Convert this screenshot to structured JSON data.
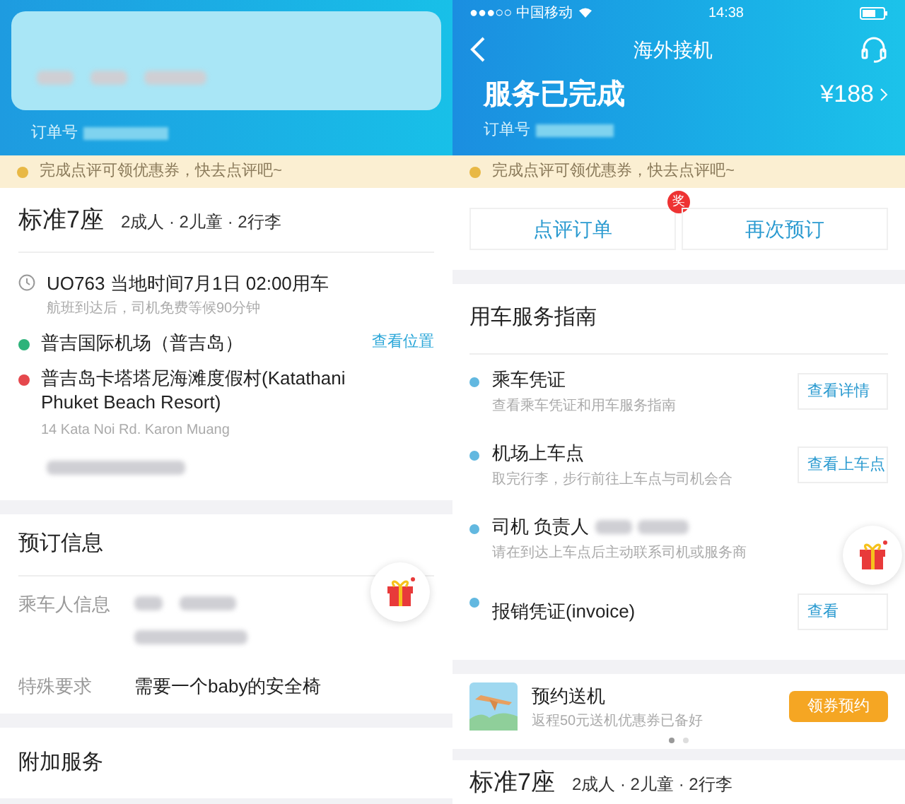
{
  "left": {
    "order_label": "订单号",
    "notice": "完成点评可领优惠券，快去点评吧~",
    "vehicle": {
      "name": "标准7座",
      "specs": "2成人 · 2儿童 · 2行李"
    },
    "flight": {
      "title": "UO763 当地时间7月1日 02:00用车",
      "note": "航班到达后，司机免费等候90分钟"
    },
    "stops": [
      {
        "name": "普吉国际机场（普吉岛）",
        "color": "#2db37a",
        "link": "查看位置"
      },
      {
        "name": "普吉岛卡塔塔尼海滩度假村(Katathani Phuket Beach Resort)",
        "color": "#e5484d",
        "address": "14 Kata Noi Rd. Karon Muang"
      }
    ],
    "booking": {
      "title": "预订信息",
      "rows": [
        {
          "label": "乘车人信息",
          "kind": "blurred"
        },
        {
          "label": "特殊要求",
          "kind": "text",
          "value": "需要一个baby的安全椅"
        }
      ]
    },
    "extra": {
      "title": "附加服务"
    }
  },
  "right": {
    "status_bar": {
      "carrier": "●●●○○ 中国移动",
      "time": "14:38"
    },
    "nav_title": "海外接机",
    "status": "服务已完成",
    "price": "¥188",
    "order_label": "订单号",
    "notice": "完成点评可领优惠券，快去点评吧~",
    "actions": [
      {
        "label": "点评订单",
        "badge": "奖"
      },
      {
        "label": "再次预订"
      }
    ],
    "guide": {
      "title": "用车服务指南",
      "items": [
        {
          "title": "乘车凭证",
          "note": "查看乘车凭证和用车服务指南",
          "button": "查看详情"
        },
        {
          "title": "机场上车点",
          "note": "取完行李，步行前往上车点与司机会合",
          "button": "查看上车点"
        },
        {
          "title": "司机 负责人",
          "note": "请在到达上车点后主动联系司机或服务商",
          "blurred": true
        },
        {
          "title": "报销凭证(invoice)",
          "button": "查看"
        }
      ]
    },
    "promo": {
      "title": "预约送机",
      "note": "返程50元送机优惠券已备好",
      "button": "领券预约"
    },
    "carousel": [
      {
        "selected": true
      },
      {
        "selected": false
      }
    ],
    "vehicle": {
      "name": "标准7座",
      "specs": "2成人 · 2儿童 · 2行李"
    }
  }
}
